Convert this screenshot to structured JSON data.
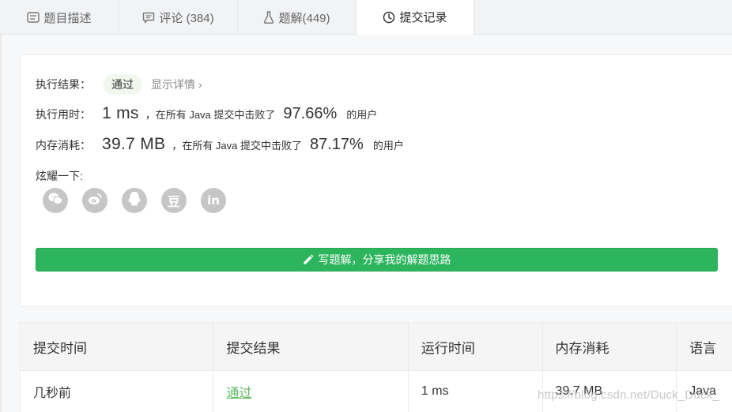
{
  "tabs": [
    {
      "label": "题目描述",
      "icon": "description-icon"
    },
    {
      "label": "评论 (384)",
      "icon": "comment-icon"
    },
    {
      "label": "题解(449)",
      "icon": "flask-icon"
    },
    {
      "label": "提交记录",
      "icon": "clock-icon"
    }
  ],
  "result": {
    "exec_label": "执行结果：",
    "status": "通过",
    "detail_link": "显示详情 ›",
    "time_label": "执行用时：",
    "time_value": "1 ms",
    "time_text": "，在所有 Java 提交中击败了",
    "time_pct": "97.66%",
    "time_users": "的用户",
    "mem_label": "内存消耗：",
    "mem_value": "39.7 MB",
    "mem_text": "，在所有 Java 提交中击败了",
    "mem_pct": "87.17%",
    "mem_users": "的用户",
    "share_label": "炫耀一下:"
  },
  "share_icons": [
    "wechat-icon",
    "weibo-icon",
    "qq-icon",
    "douban-icon",
    "linkedin-icon"
  ],
  "douban_glyph": "豆",
  "linkedin_glyph": "in",
  "write_button": "写题解，分享我的解题思路",
  "table": {
    "headers": [
      "提交时间",
      "提交结果",
      "运行时间",
      "内存消耗",
      "语言"
    ],
    "rows": [
      [
        "几秒前",
        "通过",
        "1 ms",
        "39.7 MB",
        "Java"
      ]
    ]
  },
  "watermark": "https://blog.csdn.net/Duck_Duck_",
  "colors": {
    "accent_green": "#2db55d",
    "pass_green": "#5cb85c",
    "share_grey": "#c6c6c6"
  }
}
